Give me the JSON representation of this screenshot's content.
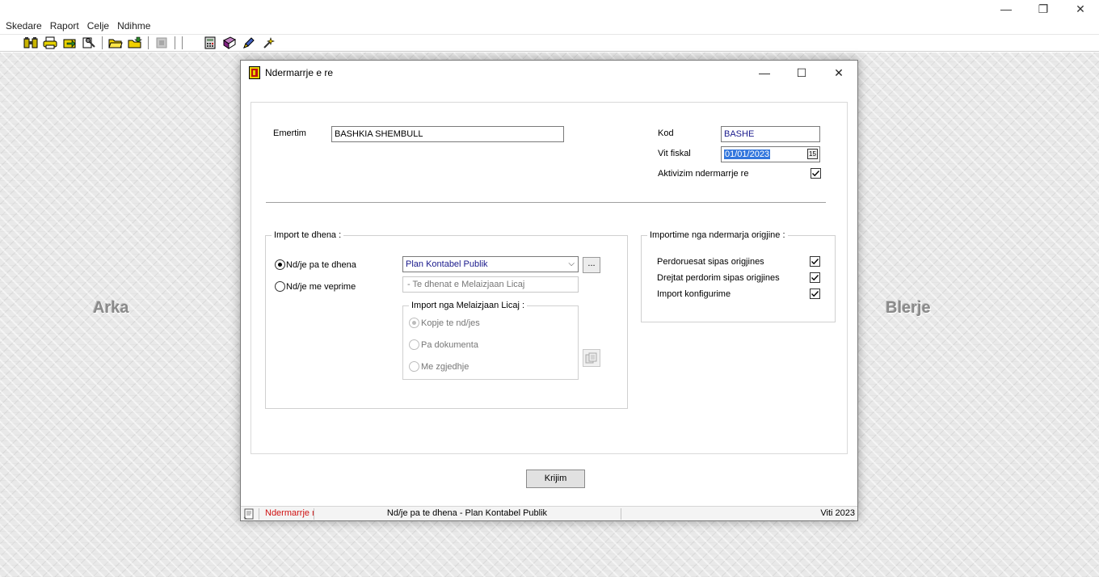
{
  "menubar": {
    "items": [
      "Skedare",
      "Raport",
      "Celje",
      "Ndihme"
    ]
  },
  "window_controls": {
    "minimize": "—",
    "restore": "❐",
    "close": "✕"
  },
  "toolbar": {
    "icons": [
      "binoculars-icon",
      "printer-icon",
      "export-icon",
      "tools-icon",
      "open-folder-icon",
      "save-folder-icon",
      "disabled-tool-icon",
      "calculator-icon",
      "book-icon",
      "pen-icon",
      "wand-icon"
    ]
  },
  "workspace": {
    "left_label": "Arka",
    "right_label": "Blerje"
  },
  "dialog": {
    "title": "Ndermarrje e re",
    "controls": {
      "minimize": "—",
      "maximize": "☐",
      "close": "✕"
    },
    "emertim_label": "Emertim",
    "emertim_value": "BASHKIA SHEMBULL",
    "kod_label": "Kod",
    "kod_value": "BASHE",
    "vit_label": "Vit fiskal",
    "vit_value": "01/01/2023",
    "calendar_glyph": "15",
    "aktivizim_label": "Aktivizim ndermarrje re",
    "aktivizim_checked": true,
    "import_group": {
      "title": "Import te dhena :",
      "radio_pa": "Nd/je pa te dhena",
      "radio_me": "Nd/je me veprime",
      "selected": "pa",
      "combo_value": "Plan Kontabel Publik",
      "combo_arrow": "⌵",
      "dots": "...",
      "source_placeholder": "- Te dhenat e Melaizjaan Licaj",
      "sub_group": {
        "title": "Import nga Melaizjaan Licaj :",
        "options": [
          "Kopje te nd/jes",
          "Pa dokumenta",
          "Me zgjedhje"
        ],
        "selected": 0
      }
    },
    "orig_group": {
      "title": "Importime nga ndermarja origjine :",
      "items": [
        {
          "label": "Perdoruesat sipas origjines",
          "checked": true
        },
        {
          "label": "Drejtat perdorim sipas origjines",
          "checked": true
        },
        {
          "label": "Import konfigurime",
          "checked": true
        }
      ]
    },
    "create_button": "Krijim",
    "status": {
      "left": "Ndermarrje re",
      "middle": "Nd/je pa te dhena - Plan Kontabel Publik",
      "right": "Viti 2023"
    }
  }
}
